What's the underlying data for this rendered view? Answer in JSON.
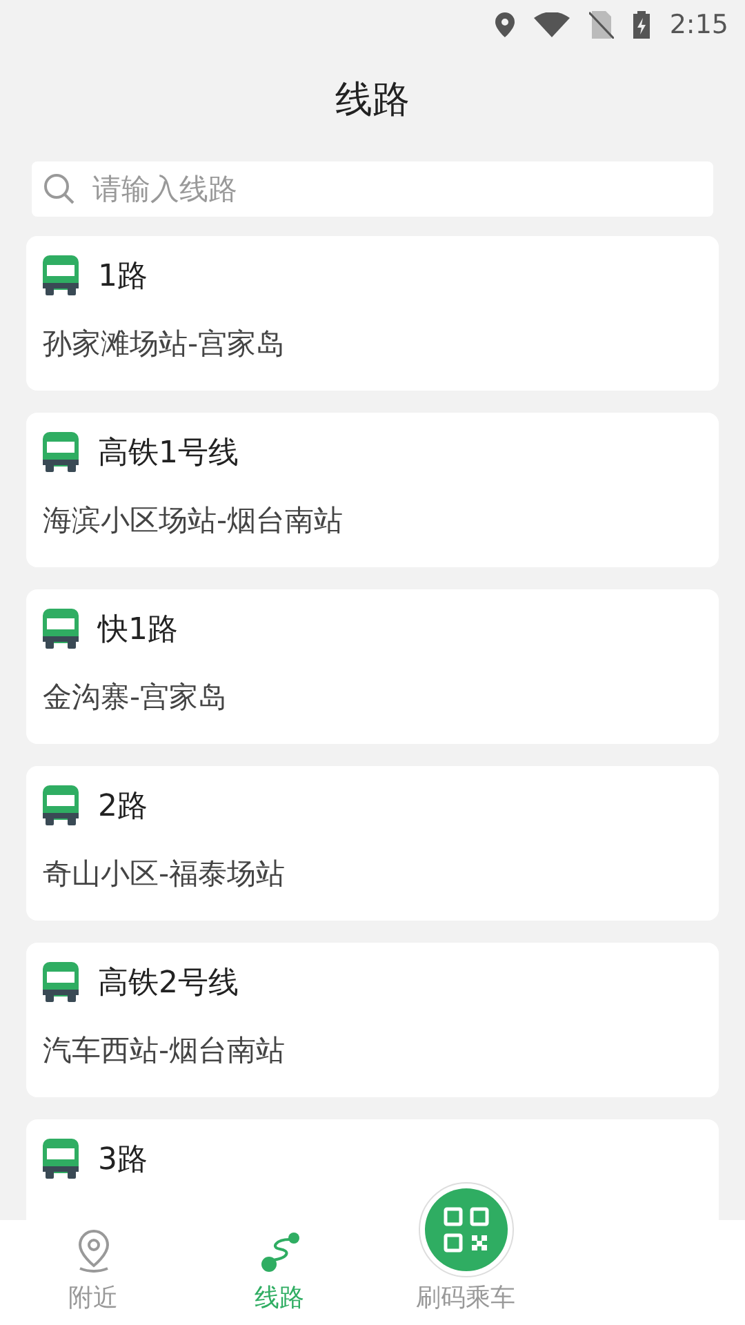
{
  "status_bar": {
    "time": "2:15"
  },
  "header": {
    "title": "线路"
  },
  "search": {
    "placeholder": "请输入线路"
  },
  "routes": [
    {
      "name": "1路",
      "stops": "孙家滩场站-宫家岛"
    },
    {
      "name": "高铁1号线",
      "stops": "海滨小区场站-烟台南站"
    },
    {
      "name": "快1路",
      "stops": "金沟寨-宫家岛"
    },
    {
      "name": "2路",
      "stops": "奇山小区-福泰场站"
    },
    {
      "name": "高铁2号线",
      "stops": "汽车西站-烟台南站"
    },
    {
      "name": "3路"
    }
  ],
  "nav": [
    {
      "kind": "nearby",
      "label": "附近",
      "selected": false
    },
    {
      "kind": "routes",
      "label": "线路",
      "selected": true
    },
    {
      "kind": "scan",
      "label": "刷码乘车",
      "selected": false
    }
  ]
}
